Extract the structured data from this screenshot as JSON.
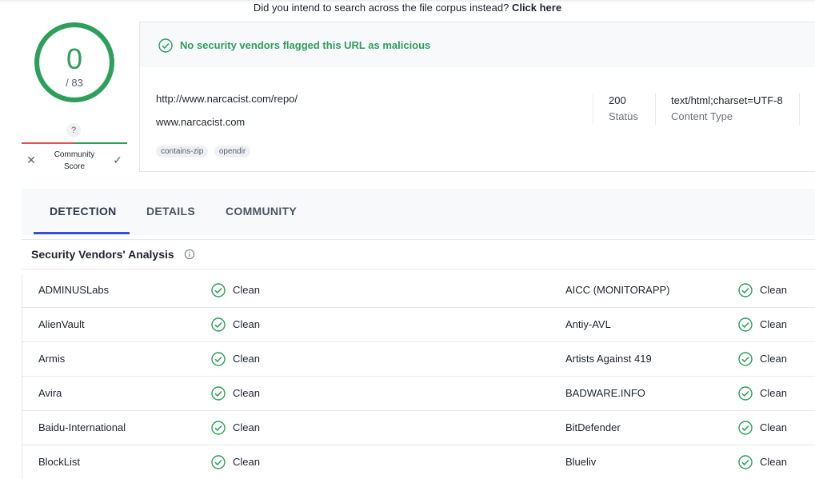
{
  "top_notice": {
    "text": "Did you intend to search across the file corpus instead?",
    "link": "Click here"
  },
  "score": {
    "detections": "0",
    "total": "/ 83",
    "color": "#2e9e5b"
  },
  "community": {
    "question": "?",
    "label": "Community Score"
  },
  "summary": {
    "banner": "No security vendors flagged this URL as malicious",
    "url": "http://www.narcacist.com/repo/",
    "domain": "www.narcacist.com",
    "tags": [
      "contains-zip",
      "opendir"
    ],
    "status_value": "200",
    "status_label": "Status",
    "content_type_value": "text/html;charset=UTF-8",
    "content_type_label": "Content Type"
  },
  "tabs": [
    {
      "label": "DETECTION",
      "active": true
    },
    {
      "label": "DETAILS",
      "active": false
    },
    {
      "label": "COMMUNITY",
      "active": false
    }
  ],
  "section": {
    "title": "Security Vendors' Analysis"
  },
  "vendors": [
    {
      "left": {
        "name": "ADMINUSLabs",
        "result": "Clean"
      },
      "right": {
        "name": "AICC (MONITORAPP)",
        "result": "Clean"
      }
    },
    {
      "left": {
        "name": "AlienVault",
        "result": "Clean"
      },
      "right": {
        "name": "Antiy-AVL",
        "result": "Clean"
      }
    },
    {
      "left": {
        "name": "Armis",
        "result": "Clean"
      },
      "right": {
        "name": "Artists Against 419",
        "result": "Clean"
      }
    },
    {
      "left": {
        "name": "Avira",
        "result": "Clean"
      },
      "right": {
        "name": "BADWARE.INFO",
        "result": "Clean"
      }
    },
    {
      "left": {
        "name": "Baidu-International",
        "result": "Clean"
      },
      "right": {
        "name": "BitDefender",
        "result": "Clean"
      }
    },
    {
      "left": {
        "name": "BlockList",
        "result": "Clean"
      },
      "right": {
        "name": "Blueliv",
        "result": "Clean"
      }
    }
  ],
  "icons": {
    "clean": "check-circle-icon",
    "info": "info-icon",
    "vote_harmless": "check-icon",
    "vote_malicious": "close-icon"
  }
}
